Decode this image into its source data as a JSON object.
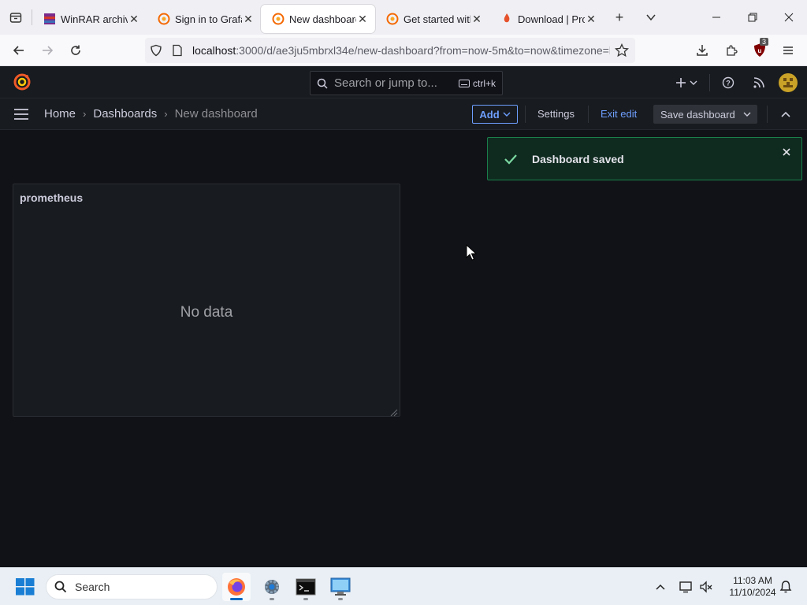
{
  "browser": {
    "tabs": [
      {
        "title": "WinRAR archive",
        "icon": "winrar-icon",
        "active": false
      },
      {
        "title": "Sign in to Grafana",
        "icon": "grafana-icon",
        "active": false
      },
      {
        "title": "New dashboard",
        "icon": "grafana-icon",
        "active": true
      },
      {
        "title": "Get started with",
        "icon": "grafana-icon",
        "active": false
      },
      {
        "title": "Download | Prometheus",
        "icon": "prometheus-icon",
        "active": false
      }
    ],
    "url_host": "localhost",
    "url_rest": ":3000/d/ae3ju5mbrxl34e/new-dashboard?from=now-5m&to=now&timezone=browser",
    "extension_badge": "3"
  },
  "grafana": {
    "search_placeholder": "Search or jump to...",
    "search_shortcut": "ctrl+k",
    "breadcrumbs": [
      "Home",
      "Dashboards",
      "New dashboard"
    ],
    "toolbar": {
      "add_label": "Add",
      "settings_label": "Settings",
      "exit_edit_label": "Exit edit",
      "save_label": "Save dashboard"
    },
    "panel": {
      "title": "prometheus",
      "empty_text": "No data"
    },
    "toast": {
      "message": "Dashboard saved",
      "status": "success"
    },
    "colors": {
      "accent_blue": "#6e9fff",
      "success_green": "#1a7f4b",
      "logo_orange": "#f05a28"
    }
  },
  "taskbar": {
    "search_label": "Search",
    "time": "11:03 AM",
    "date": "11/10/2024"
  }
}
